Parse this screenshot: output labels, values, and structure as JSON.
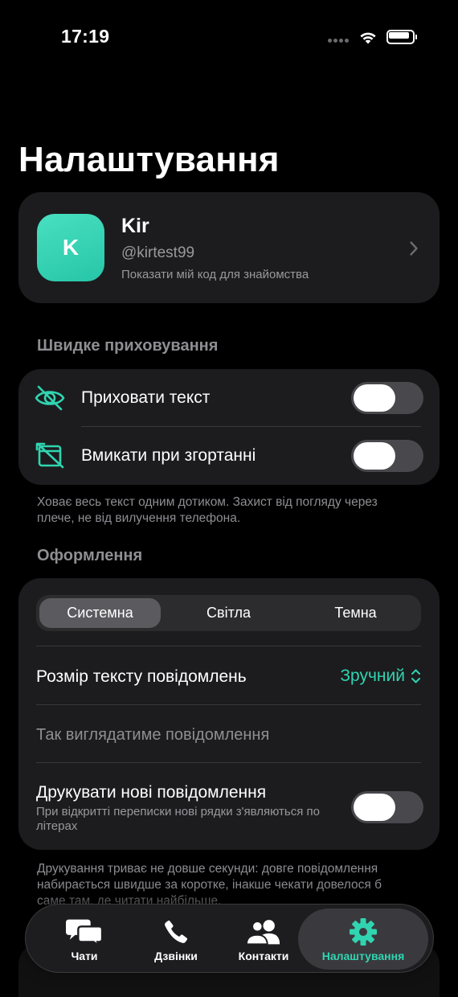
{
  "status_bar": {
    "time": "17:19"
  },
  "page_title": "Налаштування",
  "profile": {
    "avatar_letter": "K",
    "name": "Kir",
    "handle": "@kirtest99",
    "hint": "Показати мій код для знайомства"
  },
  "quick_hide": {
    "header": "Швидке приховування",
    "rows": [
      {
        "label": "Приховати текст",
        "icon": "eye-slash-icon",
        "enabled": false
      },
      {
        "label": "Вмикати при згортанні",
        "icon": "window-slash-icon",
        "enabled": false
      }
    ],
    "footnote": "Ховає весь текст одним дотиком. Захист від погляду через плече, не від вилучення телефона."
  },
  "appearance": {
    "header": "Оформлення",
    "theme_options": [
      "Системна",
      "Світла",
      "Темна"
    ],
    "selected_theme": "Системна",
    "text_size_label": "Розмір тексту повідомлень",
    "text_size_value": "Зручний",
    "preview_text": "Так виглядатиме повідомлення",
    "typing_label": "Друкувати нові повідомлення",
    "typing_sub": "При відкритті переписки нові рядки з'являються по літерах",
    "typing_enabled": false,
    "footnote": "Друкування триває не довше секунди: довге повідомлення набирається швидше за коротке, інакше чекати довелося б саме там, де читати найбільше."
  },
  "tab_bar": {
    "tabs": [
      {
        "label": "Чати",
        "icon": "chat-bubbles-icon"
      },
      {
        "label": "Дзвінки",
        "icon": "phone-icon"
      },
      {
        "label": "Контакти",
        "icon": "people-icon"
      },
      {
        "label": "Налаштування",
        "icon": "gear-icon"
      }
    ],
    "active": "Налаштування"
  },
  "colors": {
    "accent": "#30d4b0",
    "background": "#000000",
    "card": "#1c1c1e",
    "secondary_text": "#8e8e93"
  }
}
